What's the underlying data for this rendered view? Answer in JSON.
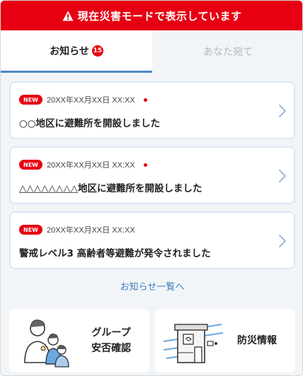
{
  "banner": {
    "text": "現在災害モードで表示しています"
  },
  "tabs": [
    {
      "label": "お知らせ",
      "badge": "15"
    },
    {
      "label": "あなた宛て"
    }
  ],
  "notices": [
    {
      "new_label": "NEW",
      "date": "20XX年XX月XX日 XX:XX",
      "title": "○○地区に避難所を開設しました",
      "unread": true
    },
    {
      "new_label": "NEW",
      "date": "20XX年XX月XX日 XX:XX",
      "title": "△△△△△△△△地区に避難所を開設しました",
      "unread": true
    },
    {
      "new_label": "NEW",
      "date": "20XX年XX月XX日 XX:XX",
      "title": "警戒レベル3 高齢者等避難が発令されました",
      "unread": false
    }
  ],
  "more_link": "お知らせ一覧へ",
  "tiles": [
    {
      "label_line1": "グループ",
      "label_line2": "安否確認",
      "icon": "family-icon"
    },
    {
      "label": "防災情報",
      "icon": "house-wind-icon"
    }
  ],
  "colors": {
    "alert_red": "#e60012",
    "accent_blue": "#4c86c6",
    "link_blue": "#3f7bc0",
    "panel_bg": "#f2f5f8"
  }
}
